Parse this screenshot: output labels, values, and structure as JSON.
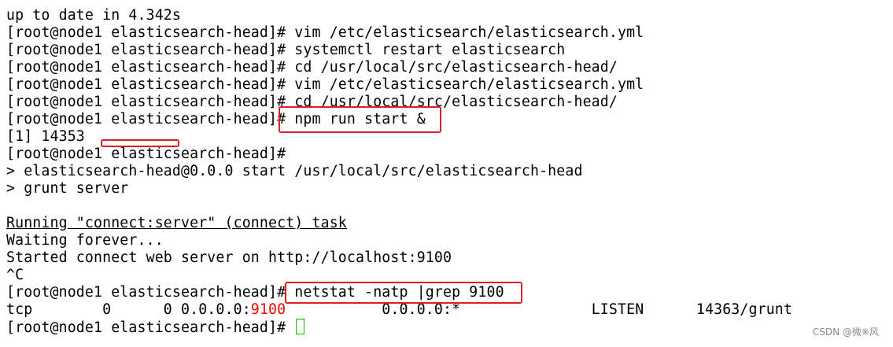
{
  "terminal": {
    "lines": {
      "l0": "up to date in 4.342s",
      "l1": "[root@node1 elasticsearch-head]# vim /etc/elasticsearch/elasticsearch.yml",
      "l2": "[root@node1 elasticsearch-head]# systemctl restart elasticsearch",
      "l3": "[root@node1 elasticsearch-head]# cd /usr/local/src/elasticsearch-head/",
      "l4": "[root@node1 elasticsearch-head]# vim /etc/elasticsearch/elasticsearch.yml",
      "l5": "[root@node1 elasticsearch-head]# cd /usr/local/src/elasticsearch-head/",
      "l6": "[root@node1 elasticsearch-head]# npm run start &",
      "l7": "[1] 14353",
      "l8": "[root@node1 elasticsearch-head]#",
      "l9": "> elasticsearch-head@0.0.0 start /usr/local/src/elasticsearch-head",
      "l10": "> grunt server",
      "l12": "Running \"connect:server\" (connect) task",
      "l13": "Waiting forever...",
      "l14": "Started connect web server on http://localhost:9100",
      "l15": "^C",
      "l16": "[root@node1 elasticsearch-head]# netstat -natp |grep 9100",
      "l17": {
        "prefix": "tcp        0      0 0.0.0.0:",
        "port": "9100",
        "suffix": "           0.0.0.0:*               LISTEN      14363/grunt"
      },
      "l18": "[root@node1 elasticsearch-head]# "
    }
  },
  "watermark": "CSDN @微※风",
  "colors": {
    "background": "#ffffff",
    "text": "#000000",
    "highlight_box": "#e02020",
    "port_highlight": "#ff0000",
    "cursor": "#00c000"
  }
}
